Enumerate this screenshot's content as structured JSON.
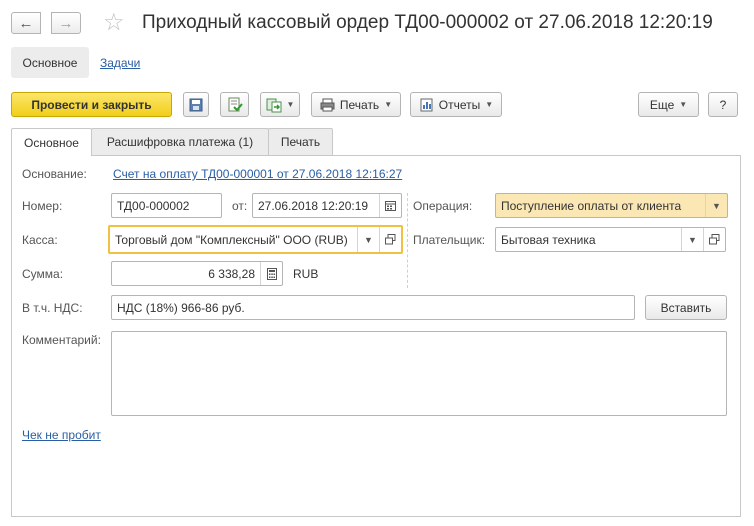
{
  "header": {
    "title": "Приходный кассовый ордер ТД00-000002 от 27.06.2018 12:20:19",
    "back_icon": "arrow-left-icon",
    "forward_icon": "arrow-right-icon",
    "favorite_icon": "star-icon"
  },
  "sections": {
    "main": "Основное",
    "tasks": "Задачи"
  },
  "toolbar": {
    "post_close": "Провести и закрыть",
    "print": "Печать",
    "reports": "Отчеты",
    "more": "Еще",
    "help": "?"
  },
  "tabs": [
    {
      "label": "Основное"
    },
    {
      "label": "Расшифровка платежа (1)"
    },
    {
      "label": "Печать"
    }
  ],
  "form": {
    "basis_label": "Основание:",
    "basis_link": "Счет на оплату ТД00-000001 от 27.06.2018 12:16:27",
    "number_label": "Номер:",
    "number_value": "ТД00-000002",
    "date_label": "от:",
    "date_value": "27.06.2018 12:20:19",
    "operation_label": "Операция:",
    "operation_value": "Поступление оплаты от клиента",
    "cash_label": "Касса:",
    "cash_value": "Торговый дом \"Комплексный\" ООО (RUB)",
    "payer_label": "Плательщик:",
    "payer_value": "Бытовая техника",
    "sum_label": "Сумма:",
    "sum_value": "6 338,28",
    "currency": "RUB",
    "vat_label": "В т.ч. НДС:",
    "vat_value": "НДС (18%) 966-86 руб.",
    "insert_button": "Вставить",
    "comment_label": "Комментарий:",
    "comment_value": "",
    "receipt_link": "Чек не пробит"
  },
  "colors": {
    "primary_button": "#f2cf1b",
    "link": "#2a5ea3",
    "focus_border": "#f0c040",
    "operation_bg": "#fbe7b4"
  }
}
